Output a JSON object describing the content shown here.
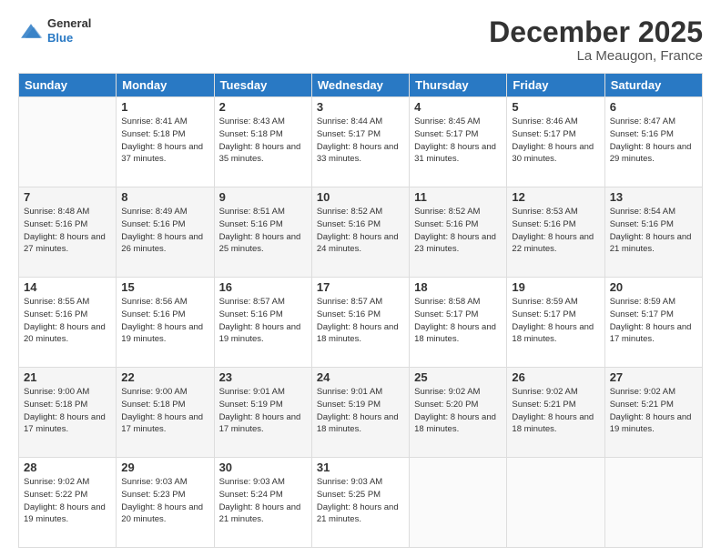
{
  "logo": {
    "general": "General",
    "blue": "Blue"
  },
  "header": {
    "month": "December 2025",
    "location": "La Meaugon, France"
  },
  "weekdays": [
    "Sunday",
    "Monday",
    "Tuesday",
    "Wednesday",
    "Thursday",
    "Friday",
    "Saturday"
  ],
  "weeks": [
    [
      {
        "date": "",
        "sunrise": "",
        "sunset": "",
        "daylight": ""
      },
      {
        "date": "1",
        "sunrise": "Sunrise: 8:41 AM",
        "sunset": "Sunset: 5:18 PM",
        "daylight": "Daylight: 8 hours and 37 minutes."
      },
      {
        "date": "2",
        "sunrise": "Sunrise: 8:43 AM",
        "sunset": "Sunset: 5:18 PM",
        "daylight": "Daylight: 8 hours and 35 minutes."
      },
      {
        "date": "3",
        "sunrise": "Sunrise: 8:44 AM",
        "sunset": "Sunset: 5:17 PM",
        "daylight": "Daylight: 8 hours and 33 minutes."
      },
      {
        "date": "4",
        "sunrise": "Sunrise: 8:45 AM",
        "sunset": "Sunset: 5:17 PM",
        "daylight": "Daylight: 8 hours and 31 minutes."
      },
      {
        "date": "5",
        "sunrise": "Sunrise: 8:46 AM",
        "sunset": "Sunset: 5:17 PM",
        "daylight": "Daylight: 8 hours and 30 minutes."
      },
      {
        "date": "6",
        "sunrise": "Sunrise: 8:47 AM",
        "sunset": "Sunset: 5:16 PM",
        "daylight": "Daylight: 8 hours and 29 minutes."
      }
    ],
    [
      {
        "date": "7",
        "sunrise": "Sunrise: 8:48 AM",
        "sunset": "Sunset: 5:16 PM",
        "daylight": "Daylight: 8 hours and 27 minutes."
      },
      {
        "date": "8",
        "sunrise": "Sunrise: 8:49 AM",
        "sunset": "Sunset: 5:16 PM",
        "daylight": "Daylight: 8 hours and 26 minutes."
      },
      {
        "date": "9",
        "sunrise": "Sunrise: 8:51 AM",
        "sunset": "Sunset: 5:16 PM",
        "daylight": "Daylight: 8 hours and 25 minutes."
      },
      {
        "date": "10",
        "sunrise": "Sunrise: 8:52 AM",
        "sunset": "Sunset: 5:16 PM",
        "daylight": "Daylight: 8 hours and 24 minutes."
      },
      {
        "date": "11",
        "sunrise": "Sunrise: 8:52 AM",
        "sunset": "Sunset: 5:16 PM",
        "daylight": "Daylight: 8 hours and 23 minutes."
      },
      {
        "date": "12",
        "sunrise": "Sunrise: 8:53 AM",
        "sunset": "Sunset: 5:16 PM",
        "daylight": "Daylight: 8 hours and 22 minutes."
      },
      {
        "date": "13",
        "sunrise": "Sunrise: 8:54 AM",
        "sunset": "Sunset: 5:16 PM",
        "daylight": "Daylight: 8 hours and 21 minutes."
      }
    ],
    [
      {
        "date": "14",
        "sunrise": "Sunrise: 8:55 AM",
        "sunset": "Sunset: 5:16 PM",
        "daylight": "Daylight: 8 hours and 20 minutes."
      },
      {
        "date": "15",
        "sunrise": "Sunrise: 8:56 AM",
        "sunset": "Sunset: 5:16 PM",
        "daylight": "Daylight: 8 hours and 19 minutes."
      },
      {
        "date": "16",
        "sunrise": "Sunrise: 8:57 AM",
        "sunset": "Sunset: 5:16 PM",
        "daylight": "Daylight: 8 hours and 19 minutes."
      },
      {
        "date": "17",
        "sunrise": "Sunrise: 8:57 AM",
        "sunset": "Sunset: 5:16 PM",
        "daylight": "Daylight: 8 hours and 18 minutes."
      },
      {
        "date": "18",
        "sunrise": "Sunrise: 8:58 AM",
        "sunset": "Sunset: 5:17 PM",
        "daylight": "Daylight: 8 hours and 18 minutes."
      },
      {
        "date": "19",
        "sunrise": "Sunrise: 8:59 AM",
        "sunset": "Sunset: 5:17 PM",
        "daylight": "Daylight: 8 hours and 18 minutes."
      },
      {
        "date": "20",
        "sunrise": "Sunrise: 8:59 AM",
        "sunset": "Sunset: 5:17 PM",
        "daylight": "Daylight: 8 hours and 17 minutes."
      }
    ],
    [
      {
        "date": "21",
        "sunrise": "Sunrise: 9:00 AM",
        "sunset": "Sunset: 5:18 PM",
        "daylight": "Daylight: 8 hours and 17 minutes."
      },
      {
        "date": "22",
        "sunrise": "Sunrise: 9:00 AM",
        "sunset": "Sunset: 5:18 PM",
        "daylight": "Daylight: 8 hours and 17 minutes."
      },
      {
        "date": "23",
        "sunrise": "Sunrise: 9:01 AM",
        "sunset": "Sunset: 5:19 PM",
        "daylight": "Daylight: 8 hours and 17 minutes."
      },
      {
        "date": "24",
        "sunrise": "Sunrise: 9:01 AM",
        "sunset": "Sunset: 5:19 PM",
        "daylight": "Daylight: 8 hours and 18 minutes."
      },
      {
        "date": "25",
        "sunrise": "Sunrise: 9:02 AM",
        "sunset": "Sunset: 5:20 PM",
        "daylight": "Daylight: 8 hours and 18 minutes."
      },
      {
        "date": "26",
        "sunrise": "Sunrise: 9:02 AM",
        "sunset": "Sunset: 5:21 PM",
        "daylight": "Daylight: 8 hours and 18 minutes."
      },
      {
        "date": "27",
        "sunrise": "Sunrise: 9:02 AM",
        "sunset": "Sunset: 5:21 PM",
        "daylight": "Daylight: 8 hours and 19 minutes."
      }
    ],
    [
      {
        "date": "28",
        "sunrise": "Sunrise: 9:02 AM",
        "sunset": "Sunset: 5:22 PM",
        "daylight": "Daylight: 8 hours and 19 minutes."
      },
      {
        "date": "29",
        "sunrise": "Sunrise: 9:03 AM",
        "sunset": "Sunset: 5:23 PM",
        "daylight": "Daylight: 8 hours and 20 minutes."
      },
      {
        "date": "30",
        "sunrise": "Sunrise: 9:03 AM",
        "sunset": "Sunset: 5:24 PM",
        "daylight": "Daylight: 8 hours and 21 minutes."
      },
      {
        "date": "31",
        "sunrise": "Sunrise: 9:03 AM",
        "sunset": "Sunset: 5:25 PM",
        "daylight": "Daylight: 8 hours and 21 minutes."
      },
      {
        "date": "",
        "sunrise": "",
        "sunset": "",
        "daylight": ""
      },
      {
        "date": "",
        "sunrise": "",
        "sunset": "",
        "daylight": ""
      },
      {
        "date": "",
        "sunrise": "",
        "sunset": "",
        "daylight": ""
      }
    ]
  ]
}
